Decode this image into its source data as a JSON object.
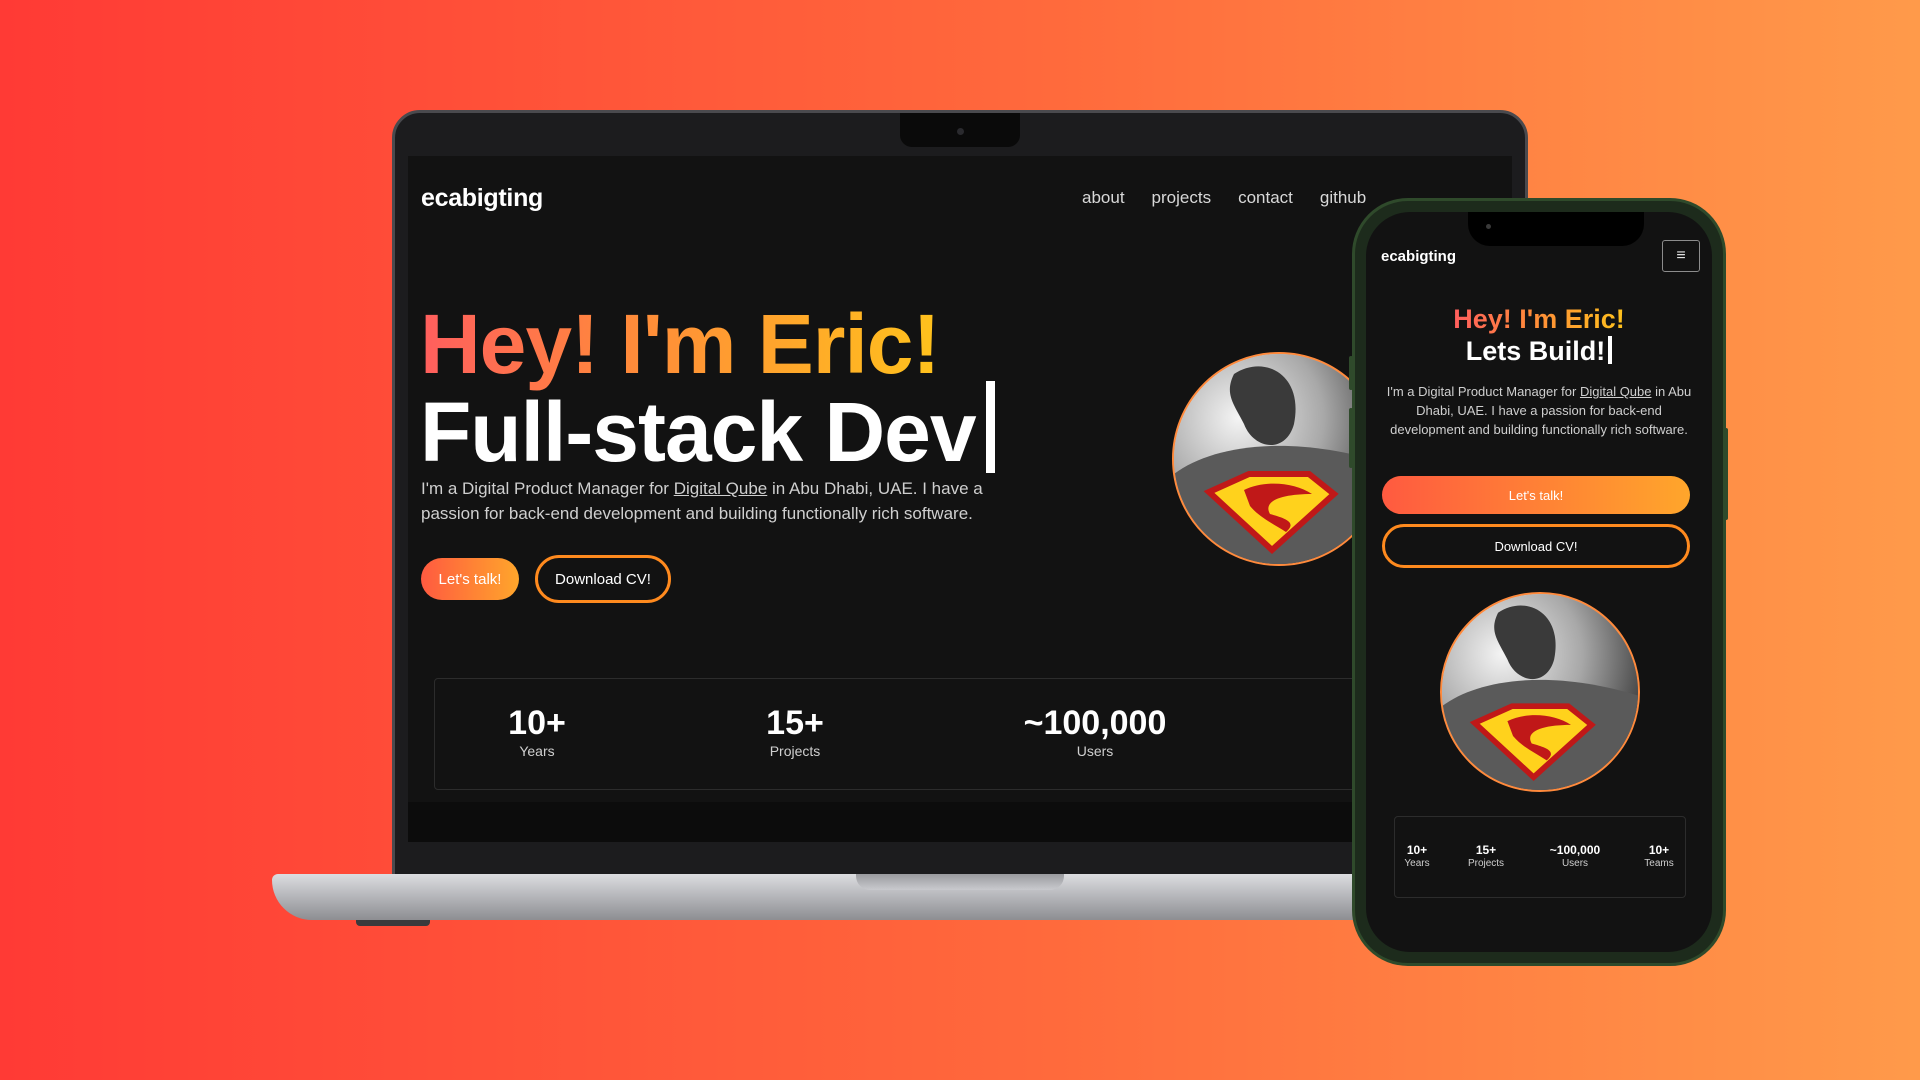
{
  "laptop": {
    "brand": "ecabigting",
    "nav": [
      "about",
      "projects",
      "contact",
      "github"
    ],
    "hero_line1": "Hey! I'm Eric!",
    "hero_line2": "Full-stack Dev",
    "description_prefix": "I'm a Digital Product Manager for ",
    "description_link": "Digital Qube",
    "description_suffix": " in Abu Dhabi, UAE. I have a passion for back-end development and building functionally rich software.",
    "button_talk": "Let's talk!",
    "button_cv": "Download CV!",
    "stats": [
      {
        "value": "10+",
        "label": "Years"
      },
      {
        "value": "15+",
        "label": "Projects"
      },
      {
        "value": "~100,000",
        "label": "Users"
      }
    ]
  },
  "phone": {
    "brand": "ecabigting",
    "menu_icon": "≡",
    "hero_line1": "Hey! I'm Eric!",
    "hero_line2": "Lets Build!",
    "description_prefix": "I'm a Digital Product Manager for ",
    "description_link": "Digital Qube",
    "description_suffix": " in Abu Dhabi, UAE. I have a passion for back-end development and building functionally rich software.",
    "button_talk": "Let's talk!",
    "button_cv": "Download CV!",
    "stats": [
      {
        "value": "10+",
        "label": "Years"
      },
      {
        "value": "15+",
        "label": "Projects"
      },
      {
        "value": "~100,000",
        "label": "Users"
      },
      {
        "value": "10+",
        "label": "Teams"
      }
    ]
  },
  "colors": {
    "background_start": "#ff3a35",
    "background_end": "#ff9a4a",
    "accent_gradient_start": "#ff5a40",
    "accent_gradient_end": "#ffa62b",
    "screen_bg": "#121212"
  }
}
